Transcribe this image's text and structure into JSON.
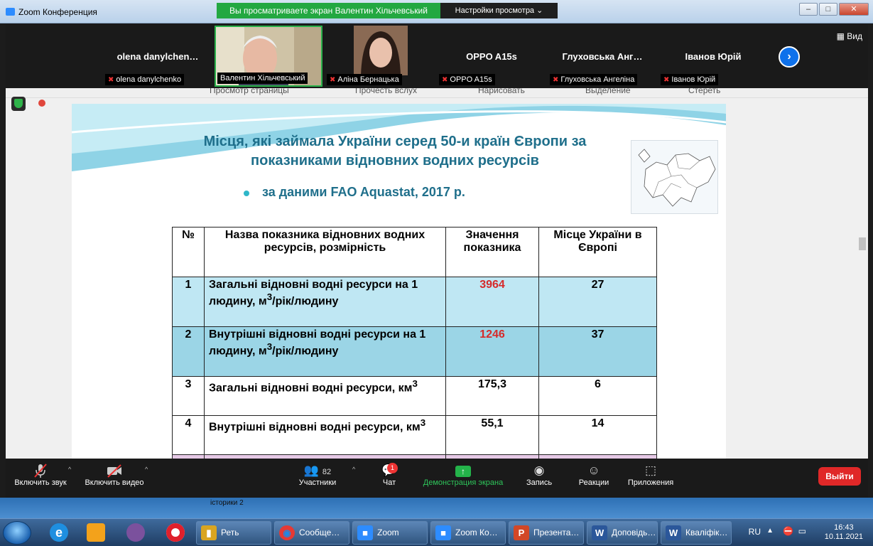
{
  "window": {
    "title": "Zoom Конференция",
    "share_banner": "Вы просматриваете экран Валентин Хільчевський",
    "view_options": "Настройки просмотра ⌄",
    "controls": [
      "‒",
      "□",
      "✕"
    ]
  },
  "participants": [
    {
      "display": "olena  danylchen…",
      "label": "olena danylchenko",
      "video": false
    },
    {
      "display": "",
      "label": "Валентин Хільчевський",
      "video": true
    },
    {
      "display": "",
      "label": "Аліна Бернацька",
      "video": true
    },
    {
      "display": "OPPO A15s",
      "label": "OPPO A15s",
      "video": false
    },
    {
      "display": "Глуховська  Анг…",
      "label": "Глуховська Ангеліна",
      "video": false
    },
    {
      "display": "Іванов Юрій",
      "label": "Іванов Юрій",
      "video": false
    }
  ],
  "view_button": "Вид",
  "browser_edge": {
    "items": [
      "Просмотр страницы",
      "Прочесть вслух",
      "Нарисовать",
      "Выделение",
      "Стереть"
    ]
  },
  "slide": {
    "title_line1": "Місця, які займала  України серед 50-и країн Європи за",
    "title_line2": "показниками відновних водних ресурсів",
    "bullet": "за даними FAO Aquastat, 2017 р.",
    "table": {
      "headers": [
        "№",
        "Назва показника відновних водних ресурсів, розмірність",
        "Значення показника",
        "Місце України в Європі"
      ],
      "rows": [
        {
          "no": "1",
          "name": "Загальні відновні водні ресурси на 1 людину, м",
          "sup": "3",
          "unit": "/рік/людину",
          "value": "3964",
          "place": "27",
          "red": true
        },
        {
          "no": "2",
          "name": "Внутрішні відновні водні ресурси на 1 людину, м",
          "sup": "3",
          "unit": "/рік/людину",
          "value": "1246",
          "place": "37",
          "red": true
        },
        {
          "no": "3",
          "name": "Загальні відновні водні ресурси, км",
          "sup": "3",
          "unit": "",
          "value": "175,3",
          "place": "6",
          "red": false
        },
        {
          "no": "4",
          "name": "Внутрішні відновні водні ресурси, км",
          "sup": "3",
          "unit": "",
          "value": "55,1",
          "place": "14",
          "red": false
        }
      ]
    }
  },
  "toolbar": {
    "mute": "Включить звук",
    "video": "Включить видео",
    "participants": "Участники",
    "participants_count": "82",
    "chat": "Чат",
    "chat_badge": "1",
    "share": "Демонстрация экрана",
    "record": "Запись",
    "reactions": "Реакции",
    "apps": "Приложения",
    "leave": "Выйти"
  },
  "below_text": "історики 2",
  "taskbar": {
    "tasks": [
      {
        "label": "Реть",
        "color": "#d9a521",
        "glyph": "▮"
      },
      {
        "label": "Сообще…",
        "color": "#ffffff",
        "glyph": "◉"
      },
      {
        "label": "Zoom",
        "color": "#2d8cff",
        "glyph": "■"
      },
      {
        "label": "Zoom Ко…",
        "color": "#2d8cff",
        "glyph": "■"
      },
      {
        "label": "Презента…",
        "color": "#d24726",
        "glyph": "P"
      },
      {
        "label": "Доповідь…",
        "color": "#2b579a",
        "glyph": "W"
      },
      {
        "label": "Кваліфік…",
        "color": "#2b579a",
        "glyph": "W"
      }
    ],
    "lang": "RU",
    "time": "16:43",
    "date": "10.11.2021"
  },
  "colors": {
    "accent_green": "#23a841",
    "leave_red": "#e02828",
    "title_blue": "#1f6f8b",
    "value_red": "#d62b2b"
  }
}
